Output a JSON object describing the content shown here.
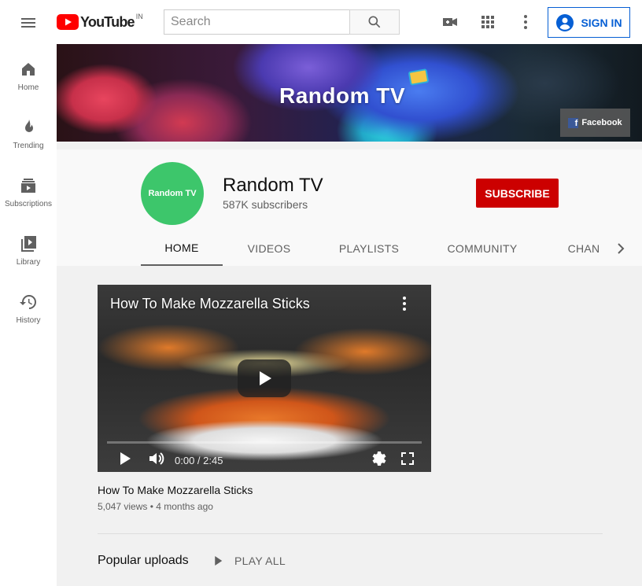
{
  "topbar": {
    "logo_text": "YouTube",
    "logo_country": "IN",
    "search_placeholder": "Search",
    "signin_label": "SIGN IN"
  },
  "sidebar": {
    "items": [
      {
        "label": "Home",
        "icon": "home-icon"
      },
      {
        "label": "Trending",
        "icon": "trending-icon"
      },
      {
        "label": "Subscriptions",
        "icon": "subscriptions-icon"
      },
      {
        "label": "Library",
        "icon": "library-icon"
      },
      {
        "label": "History",
        "icon": "history-icon"
      }
    ]
  },
  "banner": {
    "title": "Random TV",
    "link_label": "Facebook",
    "link_icon_letter": "f"
  },
  "channel": {
    "avatar_text": "Random TV",
    "name": "Random TV",
    "subscribers": "587K subscribers",
    "subscribe_label": "SUBSCRIBE"
  },
  "tabs": [
    {
      "label": "HOME",
      "active": true
    },
    {
      "label": "VIDEOS",
      "active": false
    },
    {
      "label": "PLAYLISTS",
      "active": false
    },
    {
      "label": "COMMUNITY",
      "active": false
    },
    {
      "label": "CHAN",
      "active": false
    }
  ],
  "video": {
    "overlay_title": "How To Make Mozzarella Sticks",
    "time_display": "0:00 / 2:45",
    "progress_fraction": 0.0,
    "title": "How To Make Mozzarella Sticks",
    "meta": "5,047 views • 4 months ago"
  },
  "popular": {
    "heading": "Popular uploads",
    "play_all_label": "PLAY ALL"
  },
  "colors": {
    "brand_red": "#ff0000",
    "subscribe_red": "#cc0000",
    "link_blue": "#065fd4",
    "avatar_green": "#3dc66b"
  }
}
